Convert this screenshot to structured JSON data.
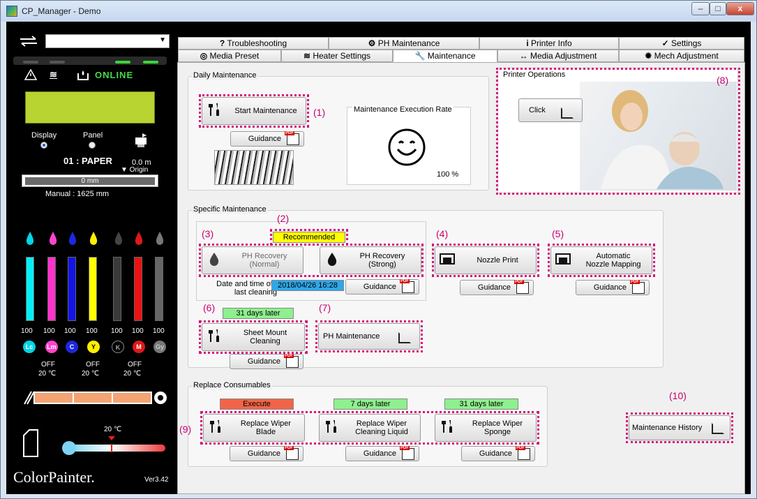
{
  "window": {
    "title": "CP_Manager - Demo",
    "buttons": [
      "–",
      "□",
      "x"
    ]
  },
  "left_panel": {
    "status": "ONLINE",
    "display_label": "Display",
    "panel_label": "Panel",
    "media_name": "01 : PAPER",
    "media_len": "0.0  m",
    "origin": "▼ Origin",
    "position": "0   mm",
    "manual": "Manual : 1625  mm",
    "inks": [
      {
        "code": "Lc",
        "level": "100",
        "color": "#00d4e8"
      },
      {
        "code": "Lm",
        "level": "100",
        "color": "#ff44cc"
      },
      {
        "code": "C",
        "level": "100",
        "color": "#1c28e0"
      },
      {
        "code": "Y",
        "level": "100",
        "color": "#ffee00"
      },
      {
        "code": "K",
        "level": "100",
        "color": "#303030"
      },
      {
        "code": "M",
        "level": "100",
        "color": "#e01818"
      },
      {
        "code": "Gy",
        "level": "100",
        "color": "#777777"
      }
    ],
    "heaters": [
      {
        "state": "OFF",
        "temp": "20 ℃"
      },
      {
        "state": "OFF",
        "temp": "20 ℃"
      },
      {
        "state": "OFF",
        "temp": "20 ℃"
      }
    ],
    "ambient_temp": "20 ℃",
    "brand": "ColorPainter.",
    "version": "Ver3.42"
  },
  "tabs_row1": [
    "Troubleshooting",
    "PH Maintenance",
    "Printer Info",
    "Settings"
  ],
  "tabs_row2": [
    "Media Preset",
    "Heater Settings",
    "Maintenance",
    "Media Adjustment",
    "Mech Adjustment"
  ],
  "daily": {
    "title": "Daily Maintenance",
    "start_btn": "Start Maintenance",
    "guidance": "Guidance",
    "rate_title": "Maintenance Execution Rate",
    "rate_value": "100 %"
  },
  "printer_ops": {
    "title": "Printer Operations",
    "click_btn": "Click"
  },
  "specific": {
    "title": "Specific Maintenance",
    "recommended": "Recommended",
    "ph_normal": "PH Recovery\n(Normal)",
    "ph_strong": "PH Recovery\n(Strong)",
    "last_cleaning_label": "Date and time of  :\nlast cleaning",
    "last_cleaning_value": "2018/04/26 16:28",
    "nozzle_print": "Nozzle Print",
    "auto_nozzle": "Automatic\nNozzle Mapping",
    "sheet_status": "31 days later",
    "sheet_btn": "Sheet Mount Cleaning",
    "ph_maint_btn": "PH Maintenance",
    "guidance": "Guidance"
  },
  "consumables": {
    "title": "Replace Consumables",
    "items": [
      {
        "status": "Execute",
        "status_color": "#f26448",
        "label": "Replace Wiper\nBlade"
      },
      {
        "status": "7 days later",
        "status_color": "#8ef08e",
        "label": "Replace Wiper\nCleaning Liquid"
      },
      {
        "status": "31 days later",
        "status_color": "#8ef08e",
        "label": "Replace Wiper\nSponge"
      }
    ],
    "guidance": "Guidance",
    "history_btn": "Maintenance History"
  },
  "annotations": [
    "(1)",
    "(2)",
    "(3)",
    "(4)",
    "(5)",
    "(6)",
    "(7)",
    "(8)",
    "(9)",
    "(10)"
  ]
}
